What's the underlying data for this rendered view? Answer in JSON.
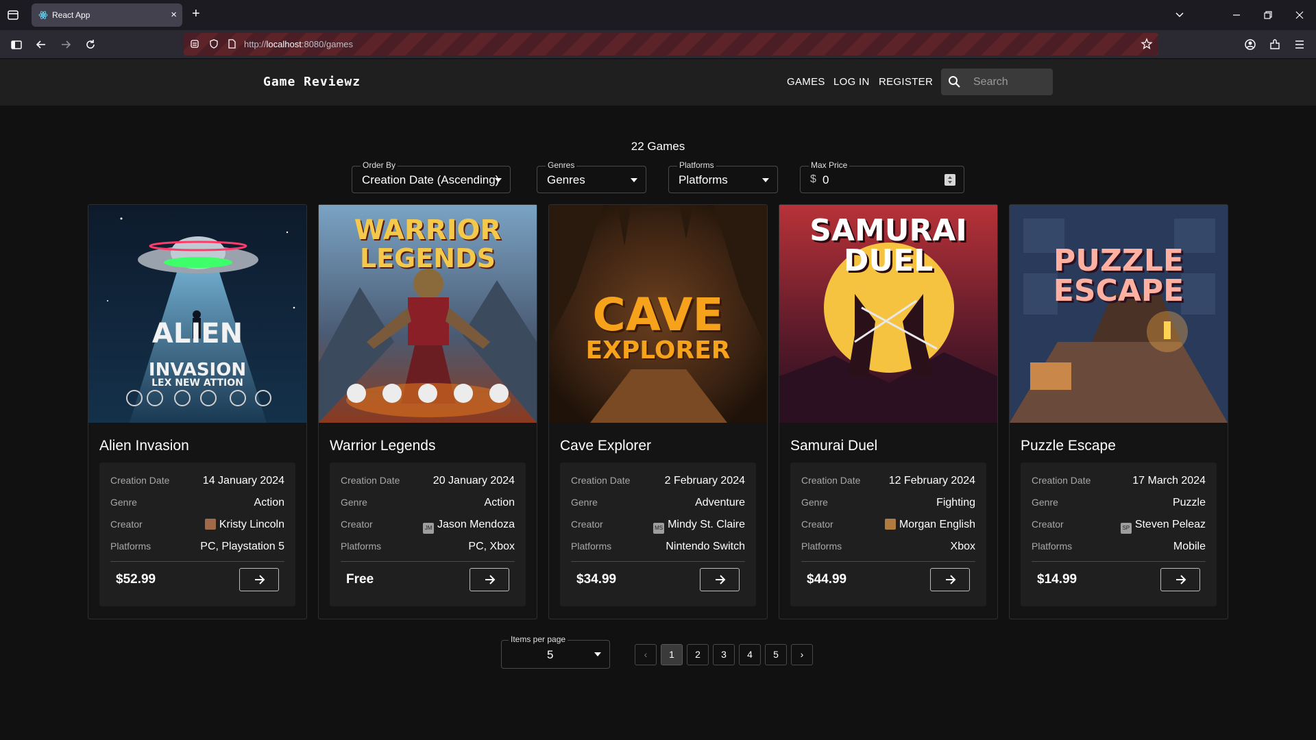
{
  "browser": {
    "tab_title": "React App",
    "tab_close": "×",
    "new_tab": "+",
    "url_prefix": "http://",
    "url_host": "localhost",
    "url_path": ":8080/games"
  },
  "header": {
    "brand": "Game Reviewz",
    "nav": [
      "GAMES",
      "LOG IN",
      "REGISTER"
    ],
    "search_placeholder": "Search"
  },
  "catalog": {
    "count_text": "22 Games",
    "filters": {
      "order_by": {
        "label": "Order By",
        "value": "Creation Date (Ascending)"
      },
      "genres": {
        "label": "Genres",
        "value": "Genres"
      },
      "platforms": {
        "label": "Platforms",
        "value": "Platforms"
      },
      "max_price": {
        "label": "Max Price",
        "currency": "$",
        "value": "0"
      }
    },
    "row_labels": {
      "creation_date": "Creation Date",
      "genre": "Genre",
      "creator": "Creator",
      "platforms": "Platforms"
    },
    "games": [
      {
        "title": "Alien Invasion",
        "cover_lines": [
          "ALIEN",
          "INVASION",
          "LEX NEW ATTION"
        ],
        "creation_date": "14 January 2024",
        "genre": "Action",
        "creator": "Kristy Lincoln",
        "creator_avatar": "",
        "platforms": "PC, Playstation 5",
        "price": "$52.99"
      },
      {
        "title": "Warrior Legends",
        "cover_lines": [
          "WARRIOR",
          "LEGENDS"
        ],
        "creation_date": "20 January 2024",
        "genre": "Action",
        "creator": "Jason Mendoza",
        "creator_avatar": "JM",
        "platforms": "PC, Xbox",
        "price": "Free"
      },
      {
        "title": "Cave Explorer",
        "cover_lines": [
          "CAVE",
          "EXPLORER"
        ],
        "creation_date": "2 February 2024",
        "genre": "Adventure",
        "creator": "Mindy St. Claire",
        "creator_avatar": "MS",
        "platforms": "Nintendo Switch",
        "price": "$34.99"
      },
      {
        "title": "Samurai Duel",
        "cover_lines": [
          "SAMURAI",
          "DUEL"
        ],
        "creation_date": "12 February 2024",
        "genre": "Fighting",
        "creator": "Morgan English",
        "creator_avatar": "",
        "platforms": "Xbox",
        "price": "$44.99"
      },
      {
        "title": "Puzzle Escape",
        "cover_lines": [
          "PUZZLE",
          "ESCAPE"
        ],
        "creation_date": "17 March 2024",
        "genre": "Puzzle",
        "creator": "Steven Peleaz",
        "creator_avatar": "SP",
        "platforms": "Mobile",
        "price": "$14.99"
      }
    ]
  },
  "pagination": {
    "items_per_page_label": "Items per page",
    "items_per_page": "5",
    "prev": "‹",
    "next": "›",
    "pages": [
      "1",
      "2",
      "3",
      "4",
      "5"
    ],
    "current_page": "1"
  },
  "icons": {
    "browser": [
      "tab-list-icon",
      "react-favicon-icon",
      "sidebar-icon",
      "back-icon",
      "forward-icon",
      "reload-icon",
      "tracking-protection-icon",
      "shield-icon",
      "page-icon",
      "bookmark-star-icon",
      "account-icon",
      "extensions-icon",
      "menu-icon",
      "minimize-icon",
      "restore-icon",
      "close-icon"
    ],
    "page": [
      "search-icon",
      "caret-down-icon",
      "arrow-right-icon",
      "number-spinner-icon"
    ]
  }
}
